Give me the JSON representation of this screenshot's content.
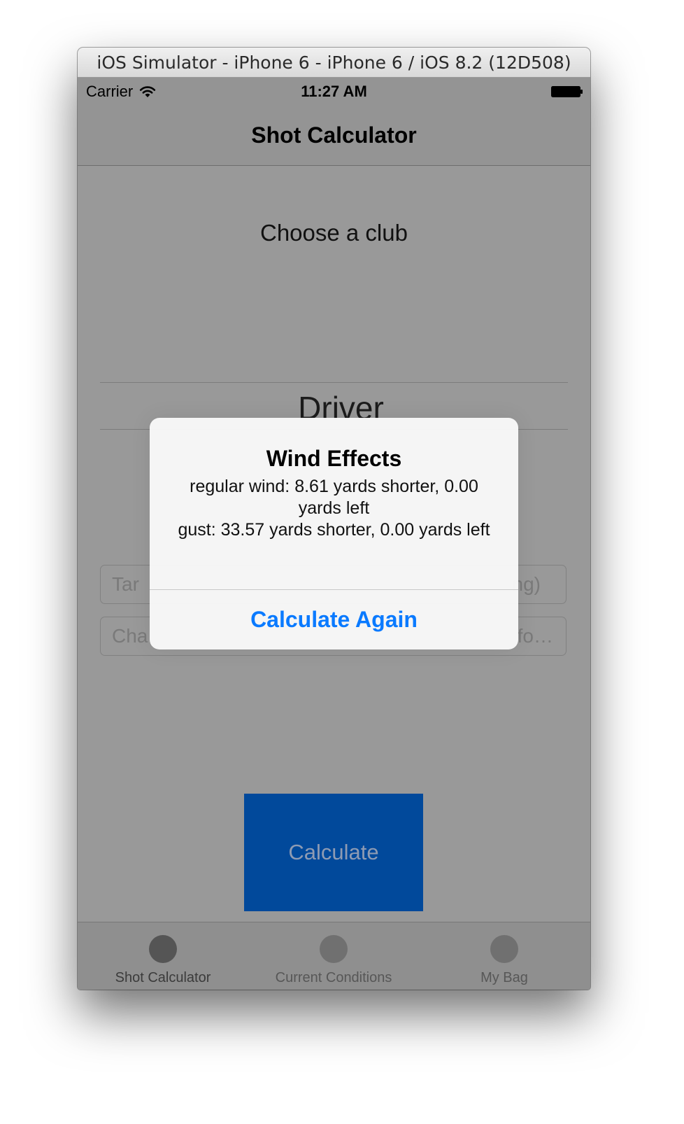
{
  "window": {
    "title": "iOS Simulator - iPhone 6 - iPhone 6 / iOS 8.2 (12D508)"
  },
  "status_bar": {
    "carrier": "Carrier",
    "time": "11:27 AM"
  },
  "nav_bar": {
    "title": "Shot Calculator"
  },
  "main": {
    "choose_club_label": "Choose a club",
    "picker_selected": "Driver",
    "field_1_left_visible": "Tar",
    "field_1_right_visible": "ng)",
    "field_2_left_visible": "Cha",
    "field_2_right_visible": "fo…",
    "calculate_label": "Calculate"
  },
  "alert": {
    "title": "Wind Effects",
    "message_line_1": "regular wind: 8.61 yards shorter, 0.00 yards left",
    "message_line_2": "gust: 33.57 yards shorter, 0.00 yards left",
    "button_label": "Calculate Again"
  },
  "tab_bar": {
    "items": [
      {
        "label": "Shot Calculator",
        "icon": "circle-icon",
        "color": "#555555"
      },
      {
        "label": "Current Conditions",
        "icon": "circle-icon",
        "color": "#707070"
      },
      {
        "label": "My Bag",
        "icon": "circle-icon",
        "color": "#707070"
      }
    ]
  },
  "colors": {
    "dimmed_background": "#999999",
    "calculate_button": "#01499b",
    "alert_button_text": "#0a7aff"
  }
}
